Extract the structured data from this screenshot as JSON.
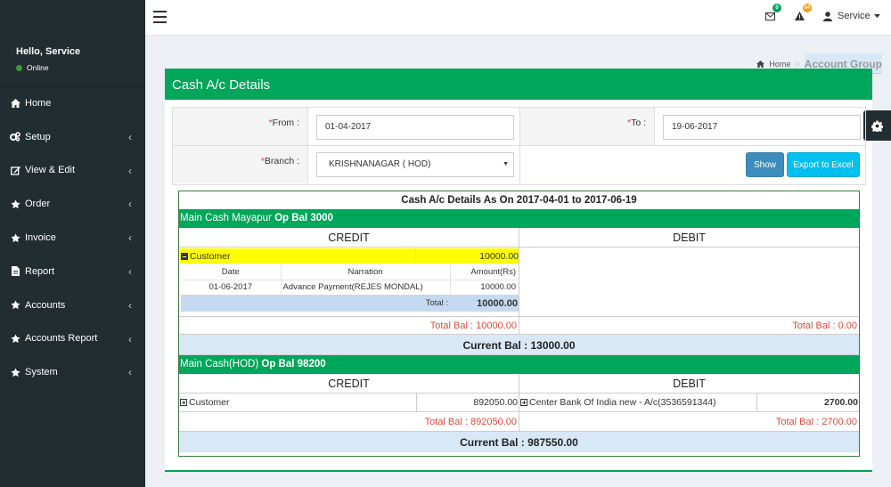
{
  "sidebar": {
    "greeting": "Hello, Service",
    "status": "Online",
    "items": [
      {
        "label": "Home",
        "icon": "home-icon",
        "has_submenu": false
      },
      {
        "label": "Setup",
        "icon": "cogs-icon",
        "has_submenu": true
      },
      {
        "label": "View & Edit",
        "icon": "edit-icon",
        "has_submenu": true
      },
      {
        "label": "Order",
        "icon": "star-icon",
        "has_submenu": true
      },
      {
        "label": "Invoice",
        "icon": "star-icon",
        "has_submenu": true
      },
      {
        "label": "Report",
        "icon": "file-icon",
        "has_submenu": true
      },
      {
        "label": "Accounts",
        "icon": "star-icon",
        "has_submenu": true
      },
      {
        "label": "Accounts Report",
        "icon": "star-icon",
        "has_submenu": true
      },
      {
        "label": "System",
        "icon": "star-icon",
        "has_submenu": true
      }
    ]
  },
  "topbar": {
    "messages_count": "0",
    "alerts_count": "84",
    "user_name": "Service",
    "colors": {
      "messages_badge": "#00a65a",
      "alerts_badge": "#f39c12"
    }
  },
  "breadcrumb": {
    "home": "Home",
    "current": "Account Group"
  },
  "page": {
    "title": "Cash A/c Details",
    "accent": "#00a65a"
  },
  "form": {
    "from_label": "From :",
    "from_value": "01-04-2017",
    "to_label": "To :",
    "to_value": "19-06-2017",
    "branch_label": "Branch :",
    "branch_value": "KRISHNANAGAR ( HOD)",
    "show_button": "Show",
    "export_button": "Export to Excel"
  },
  "report": {
    "title": "Cash A/c Details As On 2017-04-01 to 2017-06-19",
    "credit_header": "CREDIT",
    "debit_header": "DEBIT",
    "groups": [
      {
        "name": "Main Cash Mayapur ",
        "opbal": "Op Bal 3000",
        "credit_account": "Customer",
        "credit_amount": "10000.00",
        "detail_headers": {
          "date": "Date",
          "narration": "Narration",
          "amount": "Amount(Rs)"
        },
        "details": [
          {
            "date": "01-06-2017",
            "narration": "Advance Payment(REJES MONDAL)",
            "amount": "10000.00"
          }
        ],
        "detail_total_label": "Total :",
        "detail_total": "10000.00",
        "credit_total": "Total Bal : 10000.00",
        "debit_total": "Total Bal : 0.00",
        "current_bal": "Current Bal : 13000.00"
      },
      {
        "name": "Main Cash(HOD) ",
        "opbal": "Op Bal 98200",
        "credit_account": "Customer",
        "credit_amount": "892050.00",
        "debit_account": "Center Bank Of India new - A/c(3536591344)",
        "debit_amount": "2700.00",
        "credit_total": "Total Bal : 892050.00",
        "debit_total": "Total Bal : 2700.00",
        "current_bal": "Current Bal : 987550.00"
      }
    ]
  }
}
